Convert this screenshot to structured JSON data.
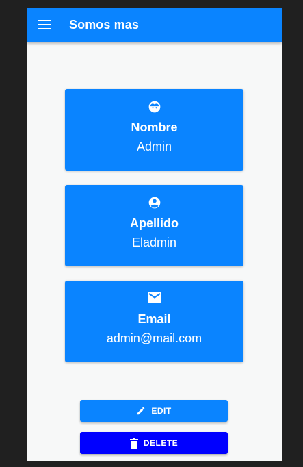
{
  "app": {
    "title": "Somos mas",
    "menu_icon": "menu-icon"
  },
  "colors": {
    "primary": "#0a84ff",
    "danger": "#0000ff",
    "background": "#f7f8f8"
  },
  "cards": [
    {
      "icon": "face-icon",
      "label": "Nombre",
      "value": "Admin"
    },
    {
      "icon": "account-circle-icon",
      "label": "Apellido",
      "value": "Eladmin"
    },
    {
      "icon": "mail-icon",
      "label": "Email",
      "value": "admin@mail.com"
    }
  ],
  "actions": {
    "edit_label": "EDIT",
    "edit_icon": "pencil-icon",
    "delete_label": "DELETE",
    "delete_icon": "trash-icon"
  }
}
